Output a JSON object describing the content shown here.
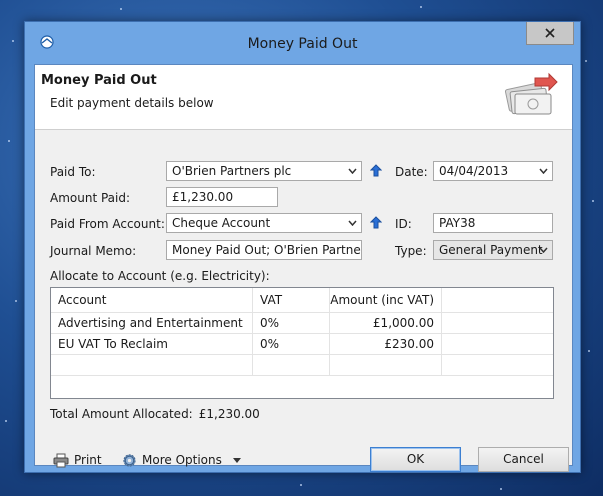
{
  "window": {
    "title": "Money Paid Out",
    "close_glyph": "✕"
  },
  "header": {
    "title": "Money Paid Out",
    "subtitle": "Edit payment details below",
    "icon": "cash-payment-icon"
  },
  "form": {
    "paid_to": {
      "label": "Paid To:",
      "value": "O'Brien Partners plc"
    },
    "amount_paid": {
      "label": "Amount Paid:",
      "value": "£1,230.00"
    },
    "paid_from": {
      "label": "Paid From Account:",
      "value": "Cheque Account"
    },
    "journal_memo": {
      "label": "Journal Memo:",
      "value": "Money Paid Out; O'Brien Partners p"
    },
    "date": {
      "label": "Date:",
      "value": "04/04/2013"
    },
    "id": {
      "label": "ID:",
      "value": "PAY38"
    },
    "type": {
      "label": "Type:",
      "value": "General Payment"
    },
    "allocate_label": "Allocate to Account (e.g. Electricity):"
  },
  "grid": {
    "columns": [
      "Account",
      "VAT",
      "Amount (inc VAT)"
    ],
    "rows": [
      {
        "account": "Advertising and Entertainment",
        "vat": "0%",
        "amount": "£1,000.00"
      },
      {
        "account": "EU VAT To Reclaim",
        "vat": "0%",
        "amount": "£230.00"
      }
    ]
  },
  "totals": {
    "label": "Total Amount Allocated:",
    "value": "£1,230.00"
  },
  "footer": {
    "print_label": "Print",
    "more_options_label": "More Options",
    "ok_label": "OK",
    "cancel_label": "Cancel"
  },
  "colors": {
    "window_frame": "#6fa6e4",
    "desktop": "#1f4f93",
    "arrow_blue": "#2a6fd6"
  }
}
